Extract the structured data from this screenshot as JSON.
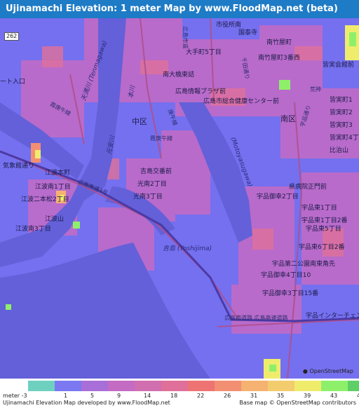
{
  "title": "Ujinamachi Elevation: 1 meter Map by www.FloodMap.net (beta)",
  "map": {
    "labels": [
      {
        "name": "label-yakusho",
        "text": "市役所南"
      },
      {
        "name": "label-kokutaiji",
        "text": "国泰寺"
      },
      {
        "name": "label-minamitakeya",
        "text": "南竹屋町"
      },
      {
        "name": "label-minamitakeya-3",
        "text": "南竹屋町3番西"
      },
      {
        "name": "label-otemachi-5",
        "text": "大手町5丁目"
      },
      {
        "name": "label-minamiohashi",
        "text": "南大橋東詰"
      },
      {
        "name": "label-plaza",
        "text": "広島情報プラザ前"
      },
      {
        "name": "label-kenko",
        "text": "広島市総合健康センター前"
      },
      {
        "name": "label-sarakai-kaikan",
        "text": "皆実会館前"
      },
      {
        "name": "label-minami-ku",
        "text": "南区"
      },
      {
        "name": "label-naka-ku",
        "text": "中区"
      },
      {
        "name": "label-kogyo",
        "text": "ート入口"
      },
      {
        "name": "label-koi",
        "text": "霞庚午線"
      },
      {
        "name": "label-koi-2",
        "text": "霞庚午線"
      },
      {
        "name": "label-minamimachi-1",
        "text": "皆実町1"
      },
      {
        "name": "label-minamimachi-2",
        "text": "皆実町2"
      },
      {
        "name": "label-minamimachi-3",
        "text": "皆実町3"
      },
      {
        "name": "label-minamimachi-4",
        "text": "皆実町4丁目"
      },
      {
        "name": "label-yoshijima-ban",
        "text": "吉島交番前"
      },
      {
        "name": "label-konan-2",
        "text": "光南2丁目"
      },
      {
        "name": "label-konan-3",
        "text": "光南3丁目"
      },
      {
        "name": "label-ebamoto",
        "text": "江波本町"
      },
      {
        "name": "label-ebaminami-1",
        "text": "江波南1丁目"
      },
      {
        "name": "label-eba-nihonmatsu",
        "text": "江波二本松2丁目"
      },
      {
        "name": "label-ebayama",
        "text": "江波山"
      },
      {
        "name": "label-ebaminami-3",
        "text": "江波南3丁目"
      },
      {
        "name": "label-kisyodai",
        "text": "気象館通り"
      },
      {
        "name": "label-yoshijima",
        "text": "吉島 (Yoshijima)"
      },
      {
        "name": "label-kenbyoin",
        "text": "県病院正門前"
      },
      {
        "name": "label-ujinaomiko-2",
        "text": "宇品御幸2丁目"
      },
      {
        "name": "label-ujinahigashi-1",
        "text": "宇品東1丁目"
      },
      {
        "name": "label-ujinahigashi-2",
        "text": "宇品東1丁目2番"
      },
      {
        "name": "label-ujinahigashi-5",
        "text": "宇品東5丁目"
      },
      {
        "name": "label-ujinahigashi-6",
        "text": "宇品東6丁目2番"
      },
      {
        "name": "label-ujina-koen",
        "text": "宇品第二公園南東角先"
      },
      {
        "name": "label-ujinaomiko-4",
        "text": "宇品御幸4丁目10"
      },
      {
        "name": "label-ujinaomiko-3",
        "text": "宇品御幸3丁目15番"
      },
      {
        "name": "label-ujina-ic",
        "text": "宇品インターチェンジ"
      },
      {
        "name": "label-expressway-3",
        "text": "広島高速3号"
      },
      {
        "name": "label-expressway-minami",
        "text": "広島南道路 広島高速道路"
      },
      {
        "name": "label-motoyasu",
        "text": "元安川"
      },
      {
        "name": "label-kyobashi",
        "text": "(Motoyasugawa)"
      },
      {
        "name": "label-tenma",
        "text": "天満川 (Tenmagawa)"
      },
      {
        "name": "label-honkawa",
        "text": "本川"
      },
      {
        "name": "label-minamiohashi-dori",
        "text": "広島市道"
      },
      {
        "name": "label-kojin",
        "text": "荒神"
      },
      {
        "name": "label-kamo",
        "text": "庚午線"
      },
      {
        "name": "label-senda",
        "text": "千田通り"
      },
      {
        "name": "label-ujina-dori",
        "text": "宇品通り"
      },
      {
        "name": "label-hijiyama",
        "text": "比治山"
      }
    ],
    "badge": "262",
    "osm_logo": "OpenStreetMap"
  },
  "legend": {
    "prefix": "meter",
    "ticks": [
      "-3",
      "1",
      "5",
      "9",
      "14",
      "18",
      "22",
      "26",
      "31",
      "35",
      "39",
      "43",
      "48"
    ],
    "colors": [
      "#6ed1c0",
      "#7b78f2",
      "#a86fd8",
      "#c46bc4",
      "#d16eb0",
      "#e0709a",
      "#ee7373",
      "#f28f73",
      "#f5b271",
      "#f3cd6d",
      "#efec6c",
      "#8ef06a",
      "#5ecf66"
    ]
  },
  "footer": {
    "left": "Ujinamachi Elevation Map developed by www.FloodMap.net",
    "right": "Base map © OpenStreetMap contributors"
  }
}
